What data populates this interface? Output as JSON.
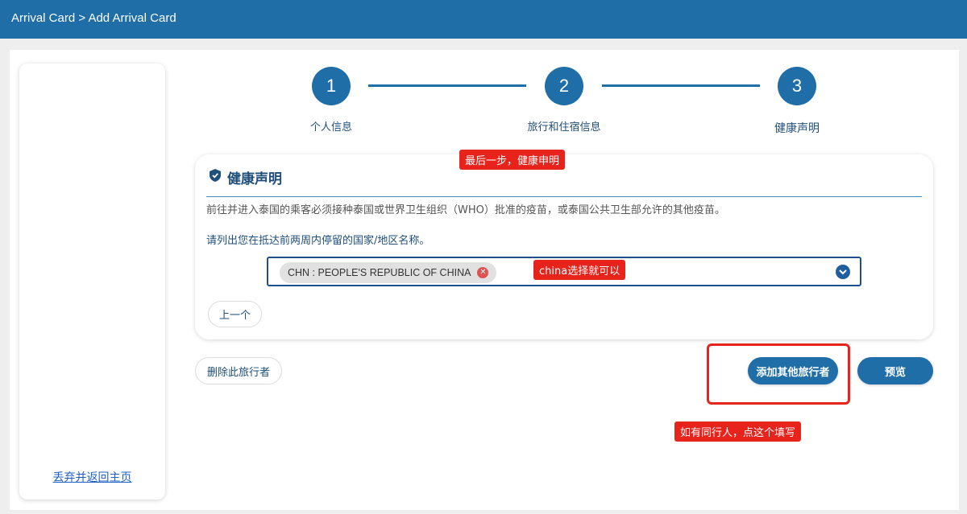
{
  "header": {
    "breadcrumb": "Arrival Card > Add Arrival Card"
  },
  "sidebar": {
    "back_link": "丢弃并返回主页"
  },
  "steps": [
    {
      "number": "1",
      "label": "个人信息"
    },
    {
      "number": "2",
      "label": "旅行和住宿信息"
    },
    {
      "number": "3",
      "label": "健康声明"
    }
  ],
  "card": {
    "icon": "shield-icon",
    "title": "健康声明",
    "description": "前往并进入泰国的乘客必须接种泰国或世界卫生组织（WHO）批准的疫苗，或泰国公共卫生部允许的其他疫苗。",
    "question": "请列出您在抵达前两周内停留的国家/地区名称。",
    "selected_country": "CHN : PEOPLE'S REPUBLIC OF CHINA",
    "prev_button": "上一个"
  },
  "actions": {
    "delete_traveler": "删除此旅行者",
    "add_traveler": "添加其他旅行者",
    "preview": "预览"
  },
  "annotations": {
    "last_step": "最后一步，健康申明",
    "choose_china": "china选择就可以",
    "companion": "如有同行人，点这个填写"
  },
  "colors": {
    "primary": "#1f6ea8",
    "annotation": "#e8231c"
  }
}
